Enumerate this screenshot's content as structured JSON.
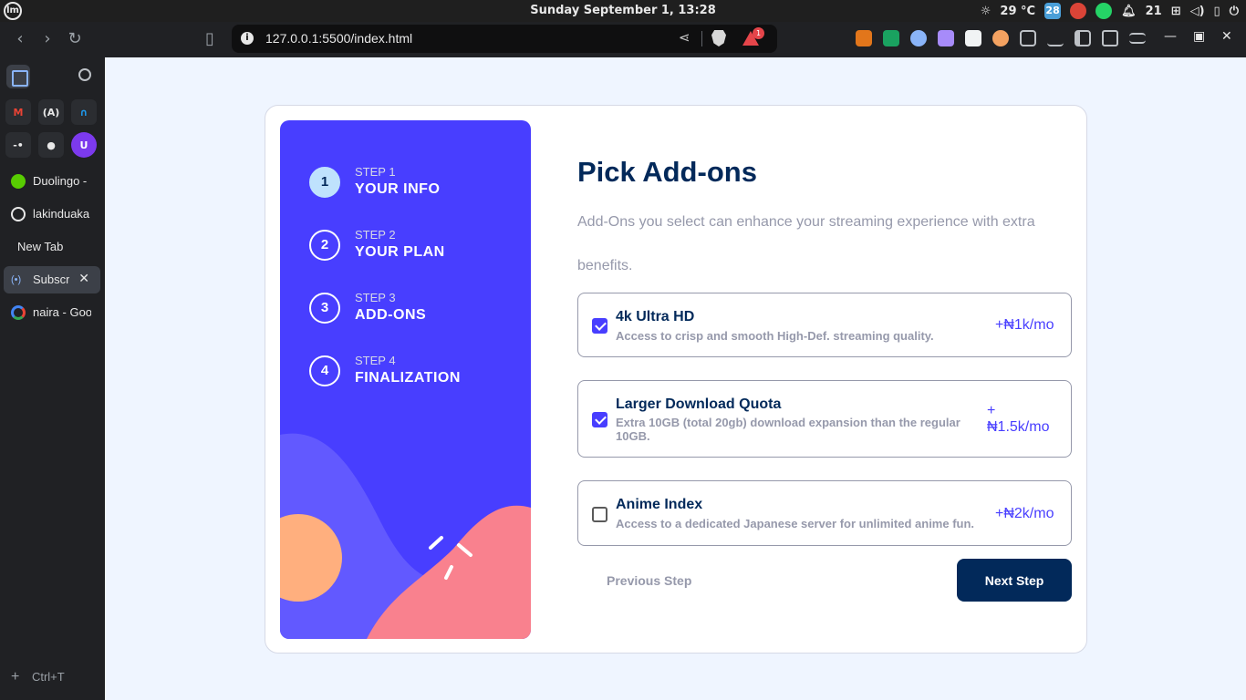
{
  "os": {
    "logo": "lm",
    "clock": "Sunday September  1, 13:28",
    "weather": "29 °C",
    "badge_count": "21",
    "calendar_day": "28"
  },
  "browser": {
    "url": "127.0.0.1:5500/index.html",
    "rewards_badge": "1",
    "tabs": [
      {
        "label": "Duolingo -",
        "icon": "duolingo-icon",
        "color": "#58cc02"
      },
      {
        "label": "lakinduaka",
        "icon": "github-icon",
        "color": "#e8e8e8"
      },
      {
        "label": "New Tab",
        "icon": "",
        "color": ""
      },
      {
        "label": "Subscr",
        "icon": "broadcast-icon",
        "color": "#8ab4f8"
      },
      {
        "label": "naira - Goo",
        "icon": "google-icon",
        "color": "#4285f4"
      }
    ],
    "new_tab_shortcut": "Ctrl+T"
  },
  "steps": [
    {
      "number": "1",
      "label": "STEP 1",
      "title": "YOUR INFO",
      "active": true
    },
    {
      "number": "2",
      "label": "STEP 2",
      "title": "YOUR PLAN",
      "active": false
    },
    {
      "number": "3",
      "label": "STEP 3",
      "title": "ADD-ONS",
      "active": false
    },
    {
      "number": "4",
      "label": "STEP 4",
      "title": "FINALIZATION",
      "active": false
    }
  ],
  "page": {
    "title": "Pick Add-ons",
    "subtitle": "Add-Ons you select can enhance your streaming experience with extra benefits."
  },
  "addons": [
    {
      "name": "4k Ultra HD",
      "description": "Access to crisp and smooth High-Def. streaming quality.",
      "price": "+₦1k/mo",
      "checked": true
    },
    {
      "name": "Larger Download Quota",
      "description": "Extra 10GB (total 20gb) download expansion than the regular 10GB.",
      "price_line1": "+",
      "price_line2": "₦1.5k/mo",
      "checked": true
    },
    {
      "name": "Anime Index",
      "description": "Access to a dedicated Japanese server for unlimited anime fun.",
      "price": "+₦2k/mo",
      "checked": false
    }
  ],
  "buttons": {
    "previous": "Previous Step",
    "next": "Next Step"
  },
  "colors": {
    "sidebar_bg": "#483eff",
    "primary_text": "#02295a",
    "accent": "#483eff",
    "muted": "#9699ab"
  }
}
